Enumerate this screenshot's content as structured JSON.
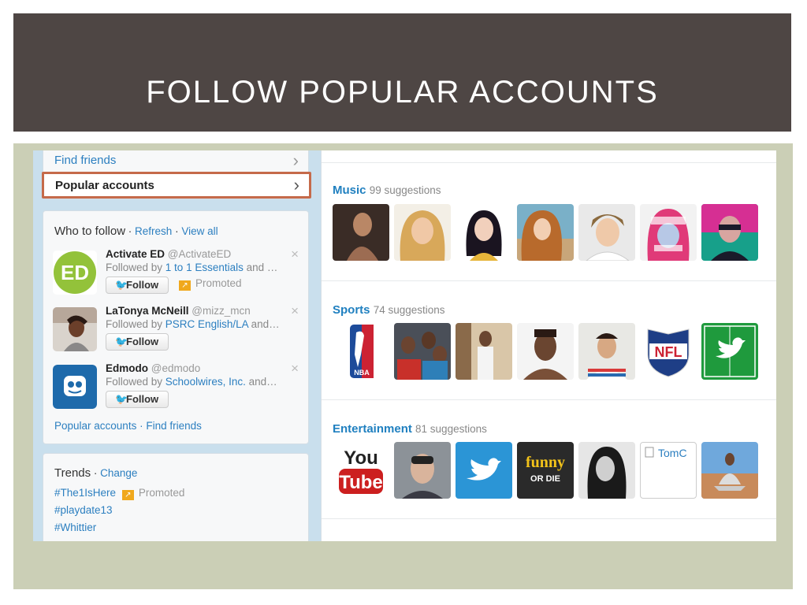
{
  "slide": {
    "title": "FOLLOW POPULAR ACCOUNTS"
  },
  "nav": {
    "find_friends": "Find friends",
    "popular_accounts": "Popular accounts",
    "chevron": "›"
  },
  "who_to_follow": {
    "title": "Who to follow",
    "sep1": " · ",
    "refresh": "Refresh",
    "sep2": " · ",
    "view_all": "View all",
    "follow_label": "Follow",
    "close_glyph": "×",
    "items": [
      {
        "name": "Activate ED",
        "handle": "@ActivateED",
        "followed_prefix": "Followed by ",
        "followed_link": "1 to 1 Essentials",
        "followed_suffix": " and …",
        "promoted": "Promoted",
        "avatar_text": "ED"
      },
      {
        "name": "LaTonya McNeill",
        "handle": "@mizz_mcn",
        "followed_prefix": "Followed by ",
        "followed_link": "PSRC English/LA",
        "followed_suffix": " and…"
      },
      {
        "name": "Edmodo",
        "handle": "@edmodo",
        "followed_prefix": "Followed by ",
        "followed_link": "Schoolwires, Inc.",
        "followed_suffix": " and…"
      }
    ],
    "footer_popular": "Popular accounts",
    "footer_sep": " · ",
    "footer_find": "Find friends"
  },
  "trends": {
    "title": "Trends",
    "sep": " · ",
    "change": "Change",
    "items": [
      "#The1IsHere",
      "#playdate13",
      "#Whittier"
    ],
    "promoted": "Promoted"
  },
  "categories": [
    {
      "name": "Music",
      "count_text": "99 suggestions"
    },
    {
      "name": "Sports",
      "count_text": "74 suggestions"
    },
    {
      "name": "Entertainment",
      "count_text": "81 suggestions"
    }
  ],
  "thumb_text": {
    "nba": "NBA",
    "nfl": "NFL",
    "youtube_top": "You",
    "youtube_bottom": "Tube",
    "funny_top": "funny",
    "funny_bottom": "OR DIE",
    "tomc": "TomC"
  },
  "colors": {
    "title_bar": "#4e4644",
    "frame": "#cbcfb6",
    "link_blue": "#2c7fc0",
    "highlight_border": "#c56a4a",
    "promoted_orange": "#f0a81c"
  }
}
